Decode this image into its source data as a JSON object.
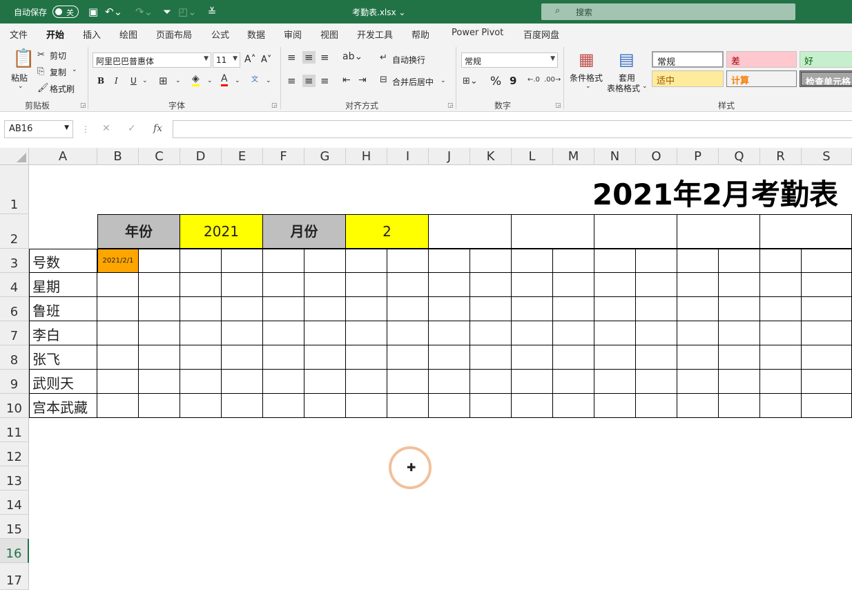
{
  "titlebar": {
    "autosave_label": "自动保存",
    "autosave_state": "关",
    "filename": "考勤表.xlsx ⌄",
    "search_placeholder": "搜索"
  },
  "tabs": [
    "文件",
    "开始",
    "插入",
    "绘图",
    "页面布局",
    "公式",
    "数据",
    "审阅",
    "视图",
    "开发工具",
    "帮助",
    "Power Pivot",
    "百度网盘"
  ],
  "active_tab": "开始",
  "ribbon": {
    "clipboard": {
      "paste": "粘贴",
      "cut": "剪切",
      "copy": "复制",
      "format_painter": "格式刷",
      "label": "剪贴板"
    },
    "font": {
      "name": "阿里巴巴普惠体",
      "size": "11",
      "label": "字体",
      "bold": "B",
      "italic": "I",
      "underline": "U"
    },
    "alignment": {
      "wrap": "自动换行",
      "merge": "合并后居中",
      "label": "对齐方式"
    },
    "number": {
      "format": "常规",
      "percent": "%",
      "comma": "9",
      "label": "数字"
    },
    "styles": {
      "conditional": "条件格式",
      "table_format_1": "套用",
      "table_format_2": "表格格式",
      "label": "样式",
      "cell_styles": [
        {
          "name": "常规",
          "bg": "#ffffff",
          "color": "#000000"
        },
        {
          "name": "差",
          "bg": "#ffc7ce",
          "color": "#9c0006"
        },
        {
          "name": "好",
          "bg": "#c6efce",
          "color": "#006100"
        },
        {
          "name": "适中",
          "bg": "#ffeb9c",
          "color": "#9c5700"
        },
        {
          "name": "计算",
          "bg": "#f2f2f2",
          "color": "#fa7d00"
        },
        {
          "name": "检查单元格",
          "bg": "#a5a5a5",
          "color": "#ffffff"
        }
      ]
    }
  },
  "formula_bar": {
    "name_box": "AB16",
    "cancel": "✕",
    "enter": "✓",
    "fx": "fx",
    "value": ""
  },
  "columns": [
    "A",
    "B",
    "C",
    "D",
    "E",
    "F",
    "G",
    "H",
    "I",
    "J",
    "K",
    "L",
    "M",
    "N",
    "O",
    "P",
    "Q",
    "R",
    "S"
  ],
  "rows": [
    "1",
    "2",
    "3",
    "4",
    "6",
    "7",
    "8",
    "9",
    "10",
    "11",
    "12",
    "13",
    "14",
    "15",
    "16",
    "17"
  ],
  "selected_row": "16",
  "sheet": {
    "title": "2021年2月考勤表",
    "year_label": "年份",
    "year_value": "2021",
    "month_label": "月份",
    "month_value": "2",
    "first_date": "2021/2/1",
    "row_labels": [
      "号数",
      "星期",
      "鲁班",
      "李白",
      "张飞",
      "武则天",
      "宫本武藏"
    ]
  },
  "colors": {
    "excel_green": "#217346",
    "header_gray": "#bfbfbf",
    "yellow": "#ffff00",
    "orange": "#ffa500"
  }
}
